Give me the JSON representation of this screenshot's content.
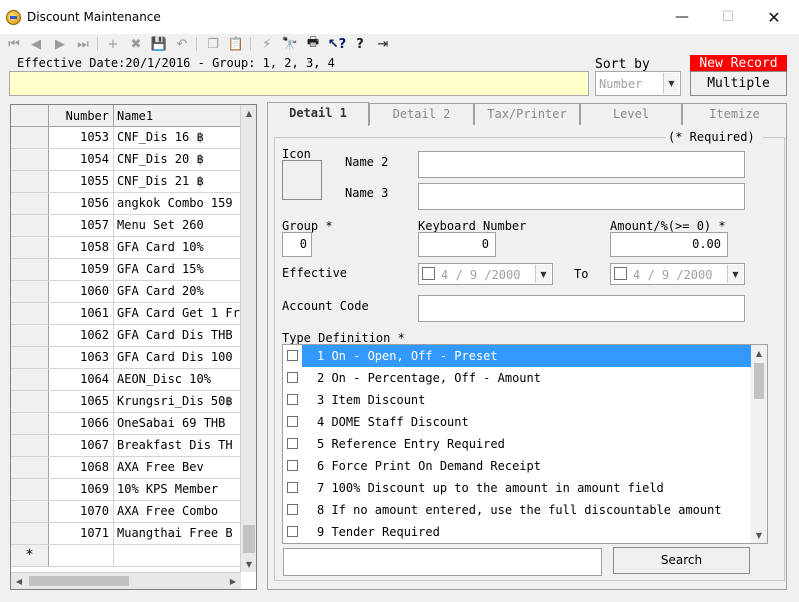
{
  "window": {
    "title": "Discount Maintenance",
    "controls": {
      "minimize": "—",
      "maximize": "☐",
      "close": "✕"
    }
  },
  "toolbar": {
    "items": [
      {
        "icon": "first-record-icon",
        "glyph": "⏮"
      },
      {
        "icon": "previous-record-icon",
        "glyph": "◀"
      },
      {
        "icon": "next-record-icon",
        "glyph": "▶"
      },
      {
        "icon": "last-record-icon",
        "glyph": "⏭"
      },
      {
        "icon": "add-icon",
        "glyph": "+"
      },
      {
        "icon": "delete-icon",
        "glyph": "✖"
      },
      {
        "icon": "save-icon",
        "glyph": "💾"
      },
      {
        "icon": "undo-icon",
        "glyph": "↶"
      },
      {
        "icon": "copy-icon",
        "glyph": "❐"
      },
      {
        "icon": "paste-icon",
        "glyph": "📋"
      },
      {
        "icon": "lightning-icon",
        "glyph": "⚡"
      },
      {
        "icon": "binoculars-icon",
        "glyph": "🔭"
      },
      {
        "icon": "print-icon",
        "glyph": "🖶"
      },
      {
        "icon": "context-help-icon",
        "glyph": "↖?"
      },
      {
        "icon": "help-icon",
        "glyph": "?"
      },
      {
        "icon": "exit-icon",
        "glyph": "⇥"
      }
    ]
  },
  "header": {
    "info": "Effective Date:20/1/2016 - Group: 1, 2, 3, 4",
    "sort_label": "Sort by",
    "sort_value": "Number",
    "status_badge": "New Record",
    "multiple_button": "Multiple"
  },
  "grid": {
    "columns": [
      "Number",
      "Name1"
    ],
    "rows": [
      {
        "number": "1053",
        "name": "CNF_Dis 16 ฿"
      },
      {
        "number": "1054",
        "name": "CNF_Dis 20 ฿"
      },
      {
        "number": "1055",
        "name": "CNF_Dis 21 ฿"
      },
      {
        "number": "1056",
        "name": "angkok Combo 159"
      },
      {
        "number": "1057",
        "name": "Menu Set 260"
      },
      {
        "number": "1058",
        "name": "GFA Card 10%"
      },
      {
        "number": "1059",
        "name": "GFA Card 15%"
      },
      {
        "number": "1060",
        "name": "GFA Card 20%"
      },
      {
        "number": "1061",
        "name": "GFA Card Get 1 Fr"
      },
      {
        "number": "1062",
        "name": "GFA Card Dis THB"
      },
      {
        "number": "1063",
        "name": "GFA Card Dis 100"
      },
      {
        "number": "1064",
        "name": "AEON_Disc 10%"
      },
      {
        "number": "1065",
        "name": "Krungsri_Dis 50฿"
      },
      {
        "number": "1066",
        "name": "OneSabai 69 THB"
      },
      {
        "number": "1067",
        "name": "Breakfast Dis TH"
      },
      {
        "number": "1068",
        "name": "AXA Free Bev"
      },
      {
        "number": "1069",
        "name": "10% KPS Member"
      },
      {
        "number": "1070",
        "name": "AXA Free Combo"
      },
      {
        "number": "1071",
        "name": "Muangthai Free B"
      }
    ],
    "new_row_marker": "*"
  },
  "tabs": [
    {
      "label": "Detail 1",
      "active": true
    },
    {
      "label": "Detail 2",
      "active": false
    },
    {
      "label": "Tax/Printer",
      "active": false
    },
    {
      "label": "Level",
      "active": false
    },
    {
      "label": "Itemize",
      "active": false
    }
  ],
  "detail": {
    "required_note": "(* Required)",
    "icon_label": "Icon",
    "name2_label": "Name 2",
    "name2_value": "",
    "name3_label": "Name 3",
    "name3_value": "",
    "group_label": "Group *",
    "group_value": "0",
    "keyboard_label": "Keyboard Number",
    "keyboard_value": "0",
    "amount_label": "Amount/%(>= 0) *",
    "amount_value": "0.00",
    "effective_label": "Effective",
    "effective_from": "4 / 9 /2000",
    "to_label": "To",
    "effective_to": "4 / 9 /2000",
    "account_label": "Account Code",
    "account_value": "",
    "type_label": "Type Definition *",
    "type_items": [
      "1 On - Open, Off - Preset",
      "2 On - Percentage, Off - Amount",
      "3 Item Discount",
      "4 DOME Staff Discount",
      "5 Reference Entry Required",
      "6 Force Print On Demand Receipt",
      "7 100% Discount up to the amount in amount field",
      "8 If no amount entered, use the full discountable amount",
      "9 Tender Required"
    ],
    "selected_type_index": 0,
    "search_value": "",
    "search_button": "Search"
  },
  "colors": {
    "selection": "#3399ff",
    "status_badge": "#ff0000",
    "info_background": "#ffffc8"
  }
}
